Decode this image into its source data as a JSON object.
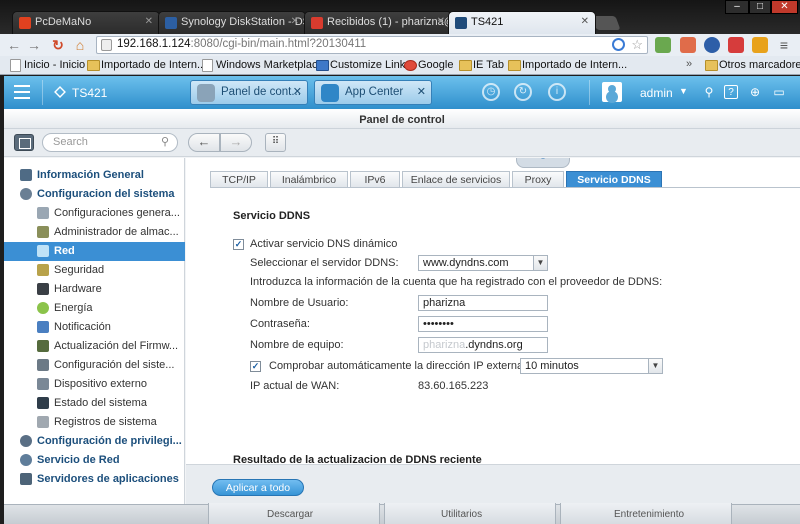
{
  "browser": {
    "tabs": [
      {
        "title": "PcDeMaNo",
        "active": false,
        "favicon_color": "#e0411f"
      },
      {
        "title": "Synology DiskStation - DS",
        "active": false,
        "favicon_color": "#2c5fa3"
      },
      {
        "title": "Recibidos (1) - pharizna@",
        "active": false,
        "favicon_color": "#d83b2e"
      },
      {
        "title": "TS421",
        "active": true,
        "favicon_color": "#1f4b7a"
      }
    ],
    "window_controls": {
      "minimize": "–",
      "maximize": "□",
      "close": "✕"
    },
    "url_host": "192.168.1.124",
    "url_rest": ":8080/cgi-bin/main.html?20130411",
    "bookmarks": [
      {
        "label": "Inicio - Inicio",
        "icon": "page"
      },
      {
        "label": "Importado de Intern...",
        "icon": "folder"
      },
      {
        "label": "Windows Marketplace",
        "icon": "page"
      },
      {
        "label": "Customize Links",
        "icon": "blue"
      },
      {
        "label": "Google",
        "icon": "google"
      },
      {
        "label": "IE Tab",
        "icon": "folder"
      },
      {
        "label": "Importado de Intern...",
        "icon": "folder"
      }
    ],
    "bookmarks_more": "»",
    "other_bookmarks": "Otros marcadores"
  },
  "dsm": {
    "device_name": "TS421",
    "app_tabs": [
      {
        "label": "Panel de cont...",
        "close": "✕"
      },
      {
        "label": "App Center",
        "close": "✕"
      }
    ],
    "user": "admin",
    "accent": "#3b8fd4",
    "window_title": "Panel de control",
    "search_placeholder": "Search",
    "sidebar": [
      {
        "label": "Información General",
        "level": "top"
      },
      {
        "label": "Configuracion del sistema",
        "level": "top"
      },
      {
        "label": "Configuraciones genera...",
        "level": "sub"
      },
      {
        "label": "Administrador de almac...",
        "level": "sub"
      },
      {
        "label": "Red",
        "level": "sub",
        "active": true
      },
      {
        "label": "Seguridad",
        "level": "sub"
      },
      {
        "label": "Hardware",
        "level": "sub"
      },
      {
        "label": "Energía",
        "level": "sub"
      },
      {
        "label": "Notificación",
        "level": "sub"
      },
      {
        "label": "Actualización del Firmw...",
        "level": "sub"
      },
      {
        "label": "Configuración del siste...",
        "level": "sub"
      },
      {
        "label": "Dispositivo externo",
        "level": "sub"
      },
      {
        "label": "Estado del sistema",
        "level": "sub"
      },
      {
        "label": "Registros de sistema",
        "level": "sub"
      },
      {
        "label": "Configuración de privilegi...",
        "level": "top"
      },
      {
        "label": "Servicio de Red",
        "level": "top"
      },
      {
        "label": "Servidores de aplicaciones",
        "level": "top"
      }
    ],
    "content_tabs": [
      "TCP/IP",
      "Inalámbrico",
      "IPv6",
      "Enlace de servicios",
      "Proxy",
      "Servicio DDNS"
    ],
    "active_tab": "Servicio DDNS",
    "ddns": {
      "section_title": "Servicio DDNS",
      "enable_label": "Activar servicio DNS dinámico",
      "enable_checked": "✓",
      "server_label": "Seleccionar el servidor DDNS:",
      "server_value": "www.dyndns.com",
      "info_text": "Introduzca la información de la cuenta que ha registrado con el proveedor de DDNS:",
      "user_label": "Nombre de Usuario:",
      "user_value": "pharizna",
      "password_label": "Contraseña:",
      "password_value": "••••••••",
      "host_label": "Nombre de equipo:",
      "host_blurred": "pharizna",
      "host_suffix": ".dyndns.org",
      "check_label": "Comprobar automáticamente la dirección IP externa.",
      "check_checked": "✓",
      "interval_value": "10 minutos",
      "wan_label": "IP actual de WAN:",
      "wan_value": "83.60.165.223",
      "result_title": "Resultado de la actualizacion de DDNS reciente"
    },
    "apply_label": "Aplicar a todo",
    "taskbar_labels": [
      "Descargar",
      "Utilitarios",
      "Entretenimiento"
    ]
  }
}
